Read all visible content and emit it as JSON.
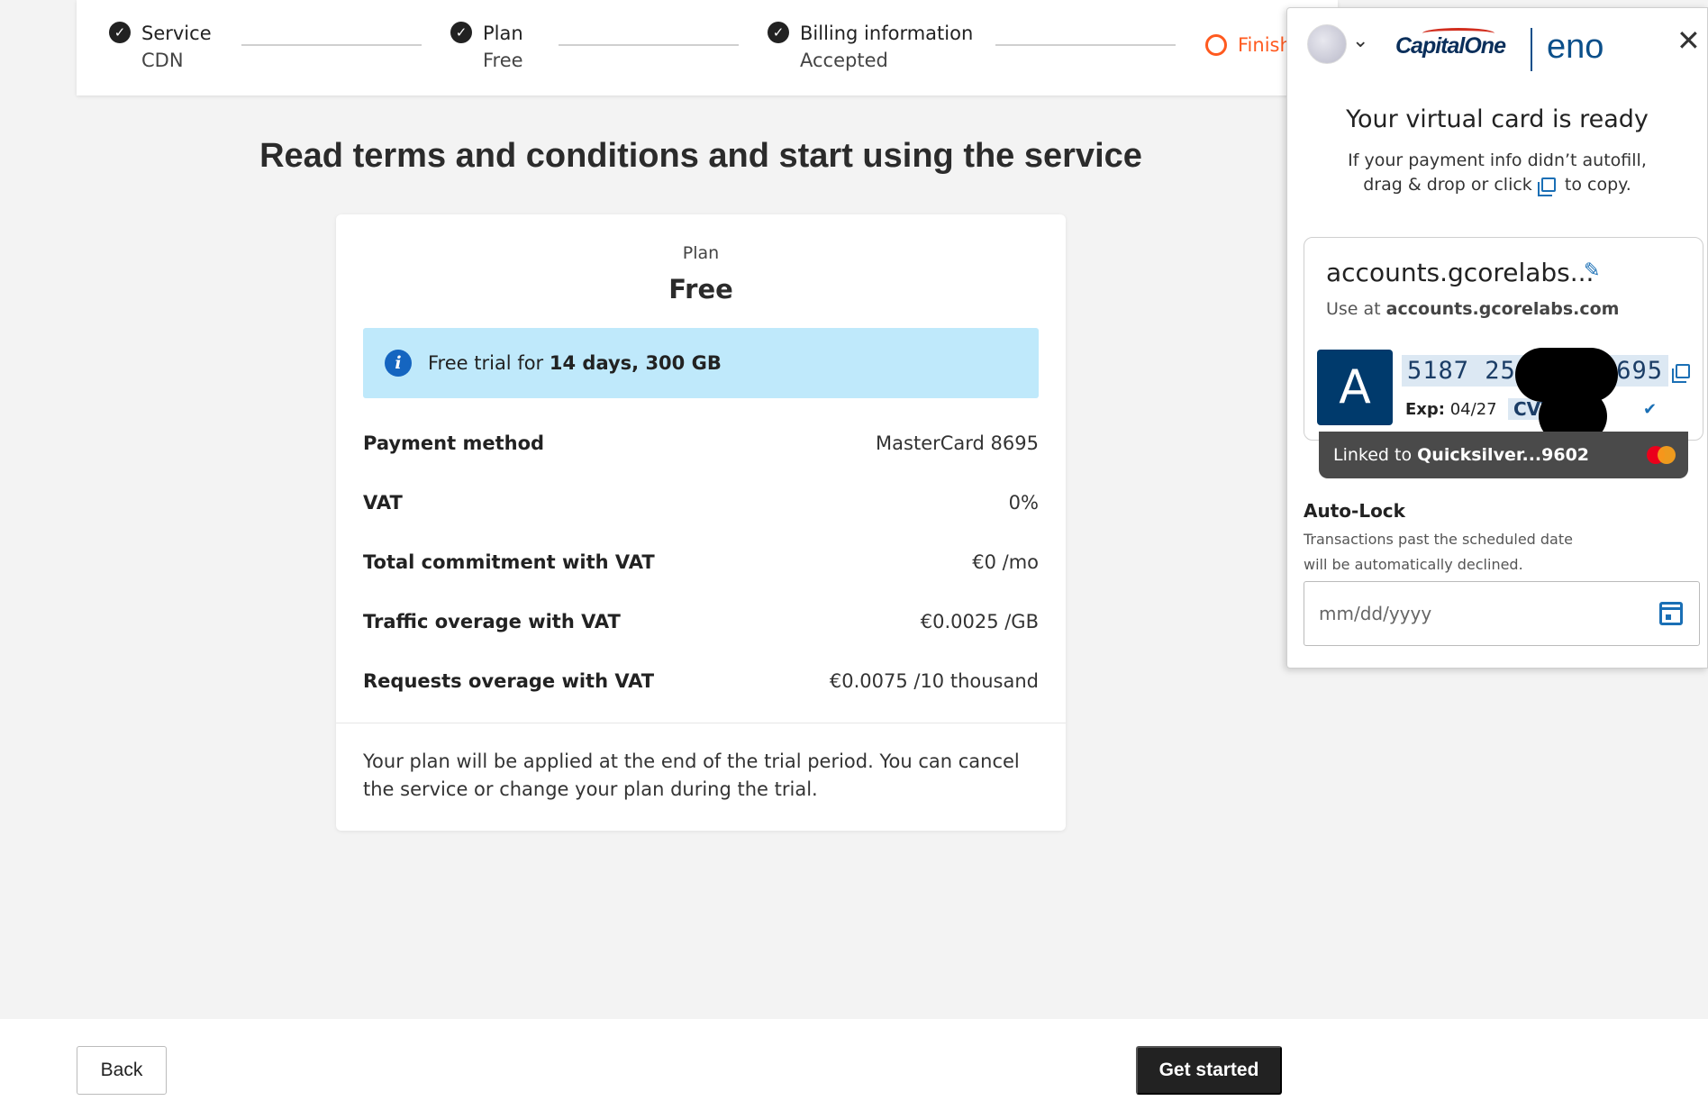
{
  "stepper": {
    "steps": [
      {
        "title": "Service",
        "subtitle": "CDN",
        "state": "done"
      },
      {
        "title": "Plan",
        "subtitle": "Free",
        "state": "done"
      },
      {
        "title": "Billing information",
        "subtitle": "Accepted",
        "state": "done"
      },
      {
        "title": "Finish",
        "subtitle": "",
        "state": "current"
      }
    ]
  },
  "main": {
    "title": "Read terms and conditions and start using the service",
    "plan_label": "Plan",
    "plan_name": "Free",
    "info": {
      "prefix": "Free trial for ",
      "bold": "14 days, 300 GB"
    },
    "rows": [
      {
        "key": "Payment method",
        "value": "MasterCard 8695"
      },
      {
        "key": "VAT",
        "value": "0%"
      },
      {
        "key": "Total commitment with VAT",
        "value": "€0 /mo"
      },
      {
        "key": "Traffic overage with VAT",
        "value": "€0.0025 /GB"
      },
      {
        "key": "Requests overage with VAT",
        "value": "€0.0075 /10 thousand"
      }
    ],
    "note": "Your plan will be applied at the end of the trial period. You can cancel the service or change your plan during the trial."
  },
  "footer": {
    "back_label": "Back",
    "start_label": "Get started"
  },
  "eno": {
    "brand": "CapitalOne",
    "product": "eno",
    "title": "Your virtual card is ready",
    "sub_line1": "If your payment info didn’t autofill,",
    "sub_line2_a": "drag & drop or click",
    "sub_line2_b": "to copy.",
    "card": {
      "merchant": "accounts.gcorelabs...",
      "use_prefix": "Use at ",
      "use_domain": "accounts.gcorelabs.com",
      "avatar_letter": "A",
      "number_start": "5187 25",
      "number_end": "8695",
      "exp_label": "Exp:",
      "exp_value": "04/27",
      "cvv_label": "CVV"
    },
    "linked_prefix": "Linked to ",
    "linked_card": "Quicksilver...9602",
    "autolock_title": "Auto-Lock",
    "autolock_desc": "Transactions past the scheduled date will be automatically declined.",
    "date_placeholder": "mm/dd/yyyy"
  },
  "icons": {
    "check": "check-circle-icon",
    "finish": "ring-icon",
    "info": "info-icon",
    "close": "close-icon",
    "copy": "copy-icon",
    "pencil": "pencil-icon",
    "calendar": "calendar-icon"
  },
  "colors": {
    "accent_orange": "#ff5a1f",
    "info_bg": "#bfe9fb",
    "eno_blue": "#0b4f8a",
    "card_navy": "#003a6c"
  }
}
